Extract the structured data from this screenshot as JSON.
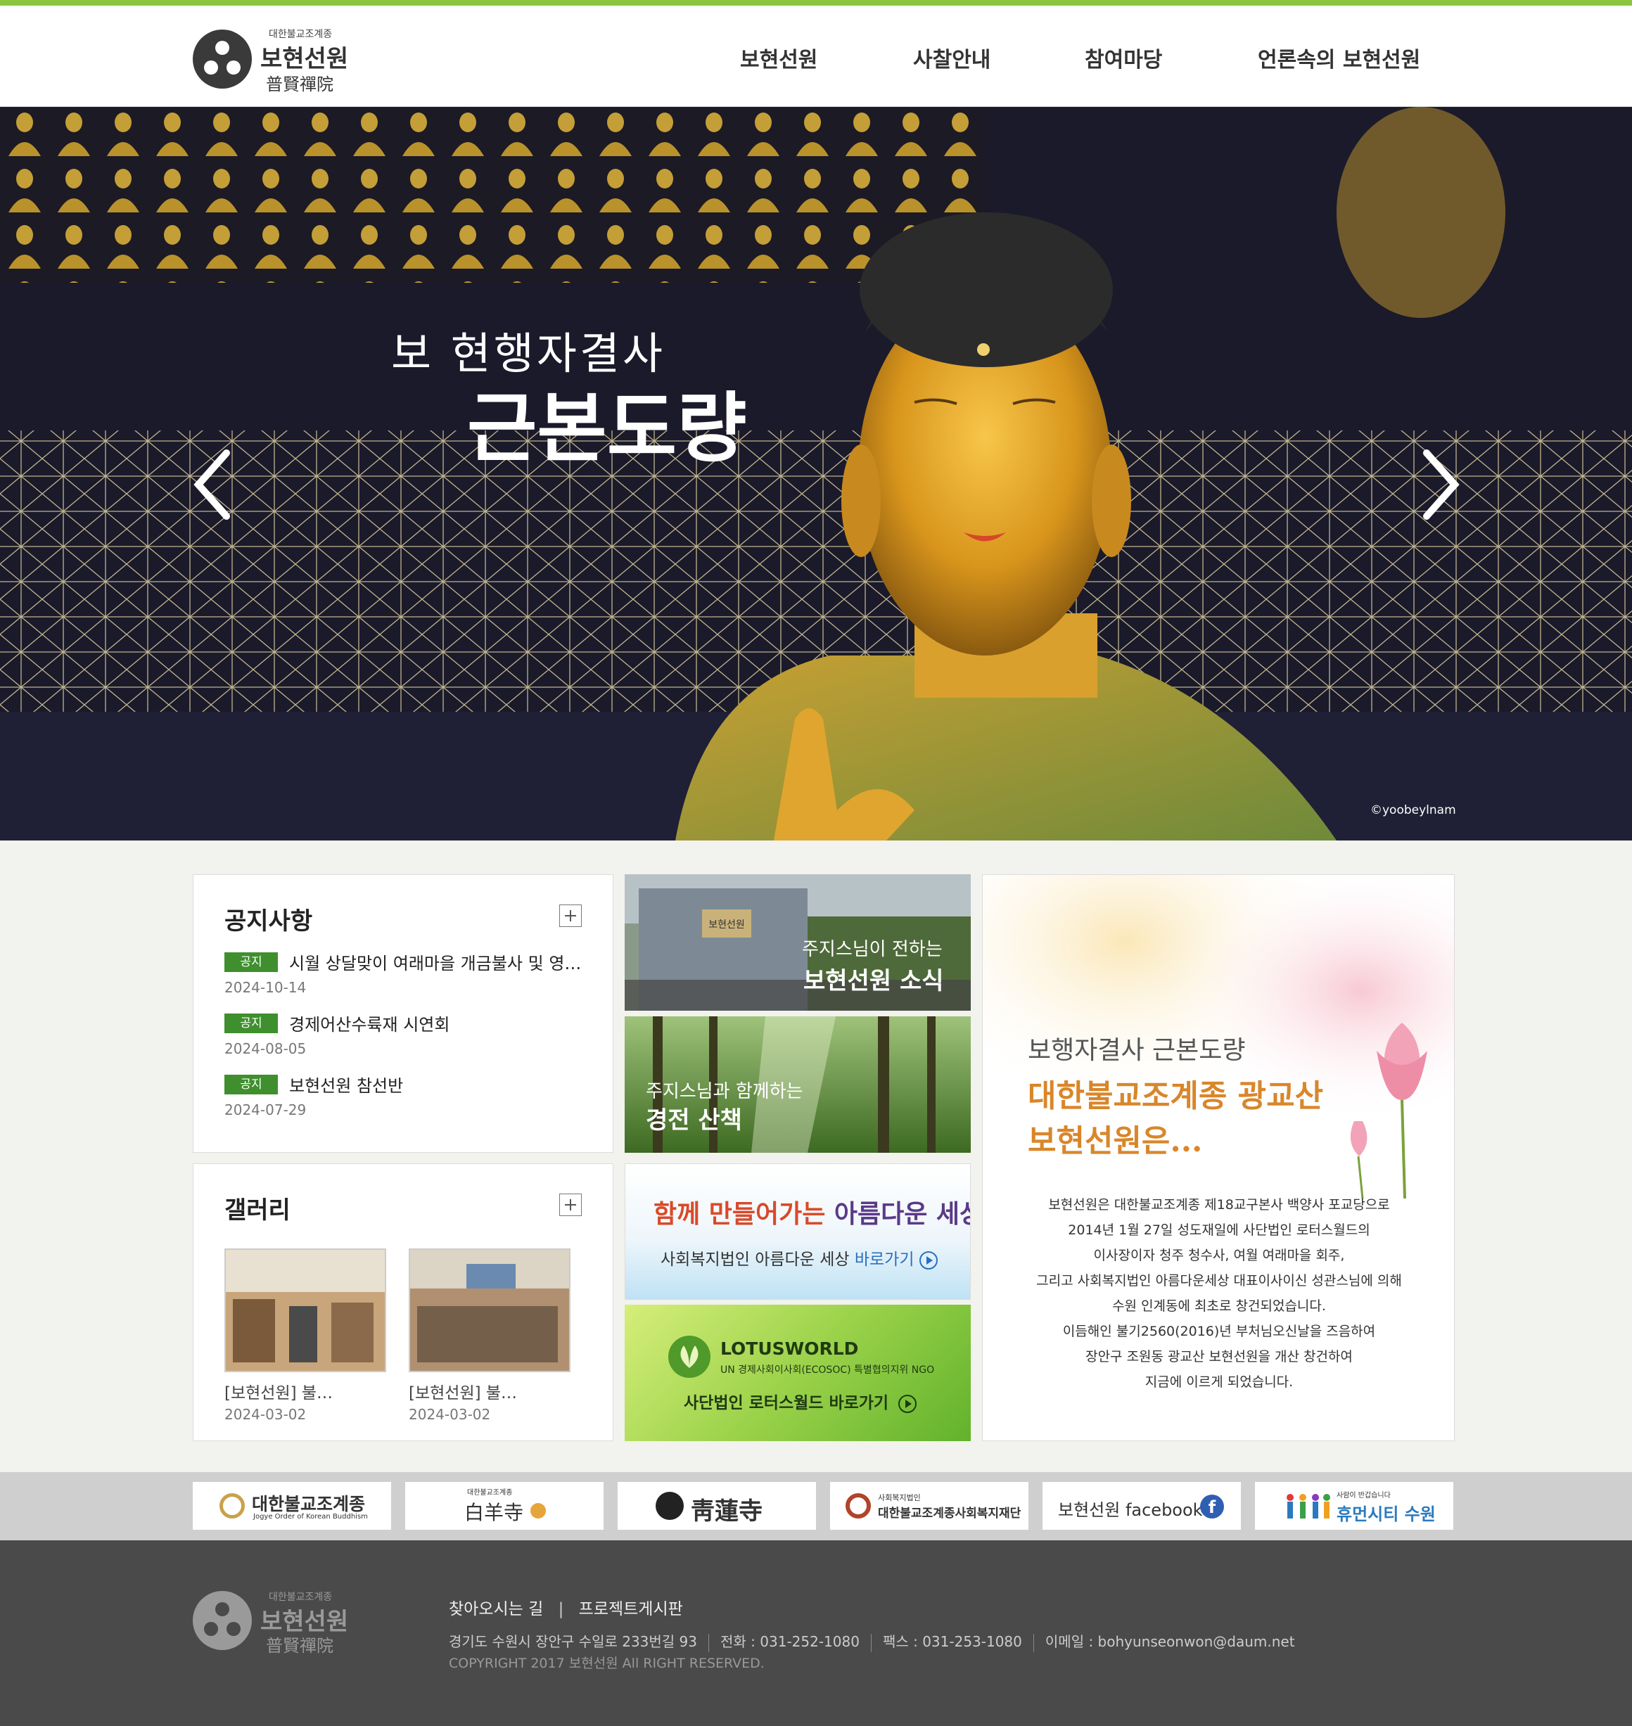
{
  "header": {
    "logo": {
      "sub": "대한불교조계종",
      "name": "보현선원",
      "hanja": "普賢禪院"
    },
    "nav": [
      "보현선원",
      "사찰안내",
      "참여마당",
      "언론속의 보현선원"
    ]
  },
  "hero": {
    "title_line1": "보 현행자결사",
    "title_line2": "근본도량",
    "credit": "©yoobeylnam"
  },
  "notice": {
    "title": "공지사항",
    "items": [
      {
        "tag": "공지",
        "title": "시월 상달맞이 여래마을 개금불사 및 영…",
        "date": "2024-10-14"
      },
      {
        "tag": "공지",
        "title": "경제어산수륙재 시연회",
        "date": "2024-08-05"
      },
      {
        "tag": "공지",
        "title": "보현선원 참선반",
        "date": "2024-07-29"
      }
    ]
  },
  "gallery": {
    "title": "갤러리",
    "items": [
      {
        "caption": "[보현선원] 불…",
        "date": "2024-03-02"
      },
      {
        "caption": "[보현선원] 불…",
        "date": "2024-03-02"
      }
    ]
  },
  "tiles": {
    "news": {
      "sub": "주지스님이 전하는",
      "main": "보현선원 소식",
      "sign_text": "보현선원"
    },
    "walk": {
      "sub": "주지스님과 함께하는",
      "main": "경전 산책"
    },
    "beautiful": {
      "headline_a": "함께 만들어가는",
      "headline_b": "아름다운 세상",
      "link_a": "사회복지법인 아름다운 세상",
      "link_b": "바로가기"
    },
    "lotus": {
      "brand": "LOTUSWORLD",
      "tagline": "UN 경제사회이사회(ECOSOC) 특별협의지위 NGO",
      "link": "사단법인 로터스월드 바로가기"
    }
  },
  "intro": {
    "line1": "보행자결사 근본도량",
    "line2": "대한불교조계종 광교산",
    "line3": "보현선원은...",
    "body": [
      "보현선원은 대한불교조계종 제18교구본사 백양사 포교당으로",
      "2014년 1월 27일 성도재일에 사단법인 로터스월드의",
      "이사장이자 청주 청수사, 여월 여래마을 회주,",
      "그리고 사회복지법인 아름다운세상 대표이사이신 성관스님에 의해",
      "수원 인계동에 최초로 창건되었습니다.",
      "이듬해인 불기2560(2016)년 부처님오신날을 즈음하여",
      "장안구 조원동 광교산 보현선원을 개산 창건하여",
      "지금에 이르게 되었습니다."
    ]
  },
  "partners": [
    {
      "text": "대한불교조계종",
      "small": "Jogye Order of Korean Buddhism",
      "icon": "jogye-logo-icon"
    },
    {
      "text": "白羊寺",
      "small": "대한불교조계종",
      "icon": "baekyangsa-logo-icon"
    },
    {
      "text": "靑蓮寺",
      "small": "",
      "icon": "cheongnyeonsa-logo-icon"
    },
    {
      "text": "대한불교조계종사회복지재단",
      "small": "사회복지법인",
      "icon": "welfare-foundation-logo-icon"
    },
    {
      "text": "보현선원 facebook",
      "small": "",
      "icon": "facebook-icon"
    },
    {
      "text": "휴먼시티 수원",
      "small": "사람이 반갑습니다",
      "icon": "suwon-city-logo-icon"
    }
  ],
  "footer": {
    "logo": {
      "sub": "대한불교조계종",
      "name": "보현선원",
      "hanja": "普賢禪院"
    },
    "links": [
      "찾아오시는 길",
      "프로젝트게시판"
    ],
    "address": "경기도 수원시 장안구 수일로 233번길 93",
    "phone": "전화 : 031-252-1080",
    "fax": "팩스 : 031-253-1080",
    "email": "이메일 : bohyunseonwon@daum.net",
    "copyright": "COPYRIGHT 2017 보현선원 All RIGHT RESERVED."
  },
  "colors": {
    "accent": "#8cc63f",
    "notice_tag": "#3f8f2e",
    "intro_title": "#d9862a",
    "footer_bg": "#4a4a4a"
  }
}
